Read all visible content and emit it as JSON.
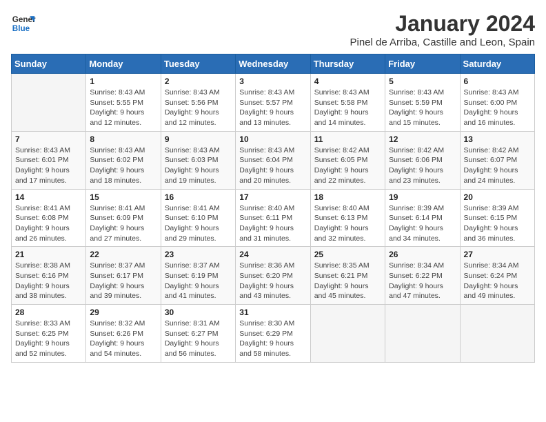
{
  "logo": {
    "line1": "General",
    "line2": "Blue"
  },
  "title": "January 2024",
  "subtitle": "Pinel de Arriba, Castille and Leon, Spain",
  "days_of_week": [
    "Sunday",
    "Monday",
    "Tuesday",
    "Wednesday",
    "Thursday",
    "Friday",
    "Saturday"
  ],
  "weeks": [
    [
      {
        "num": "",
        "detail": ""
      },
      {
        "num": "1",
        "detail": "Sunrise: 8:43 AM\nSunset: 5:55 PM\nDaylight: 9 hours\nand 12 minutes."
      },
      {
        "num": "2",
        "detail": "Sunrise: 8:43 AM\nSunset: 5:56 PM\nDaylight: 9 hours\nand 12 minutes."
      },
      {
        "num": "3",
        "detail": "Sunrise: 8:43 AM\nSunset: 5:57 PM\nDaylight: 9 hours\nand 13 minutes."
      },
      {
        "num": "4",
        "detail": "Sunrise: 8:43 AM\nSunset: 5:58 PM\nDaylight: 9 hours\nand 14 minutes."
      },
      {
        "num": "5",
        "detail": "Sunrise: 8:43 AM\nSunset: 5:59 PM\nDaylight: 9 hours\nand 15 minutes."
      },
      {
        "num": "6",
        "detail": "Sunrise: 8:43 AM\nSunset: 6:00 PM\nDaylight: 9 hours\nand 16 minutes."
      }
    ],
    [
      {
        "num": "7",
        "detail": "Sunrise: 8:43 AM\nSunset: 6:01 PM\nDaylight: 9 hours\nand 17 minutes."
      },
      {
        "num": "8",
        "detail": "Sunrise: 8:43 AM\nSunset: 6:02 PM\nDaylight: 9 hours\nand 18 minutes."
      },
      {
        "num": "9",
        "detail": "Sunrise: 8:43 AM\nSunset: 6:03 PM\nDaylight: 9 hours\nand 19 minutes."
      },
      {
        "num": "10",
        "detail": "Sunrise: 8:43 AM\nSunset: 6:04 PM\nDaylight: 9 hours\nand 20 minutes."
      },
      {
        "num": "11",
        "detail": "Sunrise: 8:42 AM\nSunset: 6:05 PM\nDaylight: 9 hours\nand 22 minutes."
      },
      {
        "num": "12",
        "detail": "Sunrise: 8:42 AM\nSunset: 6:06 PM\nDaylight: 9 hours\nand 23 minutes."
      },
      {
        "num": "13",
        "detail": "Sunrise: 8:42 AM\nSunset: 6:07 PM\nDaylight: 9 hours\nand 24 minutes."
      }
    ],
    [
      {
        "num": "14",
        "detail": "Sunrise: 8:41 AM\nSunset: 6:08 PM\nDaylight: 9 hours\nand 26 minutes."
      },
      {
        "num": "15",
        "detail": "Sunrise: 8:41 AM\nSunset: 6:09 PM\nDaylight: 9 hours\nand 27 minutes."
      },
      {
        "num": "16",
        "detail": "Sunrise: 8:41 AM\nSunset: 6:10 PM\nDaylight: 9 hours\nand 29 minutes."
      },
      {
        "num": "17",
        "detail": "Sunrise: 8:40 AM\nSunset: 6:11 PM\nDaylight: 9 hours\nand 31 minutes."
      },
      {
        "num": "18",
        "detail": "Sunrise: 8:40 AM\nSunset: 6:13 PM\nDaylight: 9 hours\nand 32 minutes."
      },
      {
        "num": "19",
        "detail": "Sunrise: 8:39 AM\nSunset: 6:14 PM\nDaylight: 9 hours\nand 34 minutes."
      },
      {
        "num": "20",
        "detail": "Sunrise: 8:39 AM\nSunset: 6:15 PM\nDaylight: 9 hours\nand 36 minutes."
      }
    ],
    [
      {
        "num": "21",
        "detail": "Sunrise: 8:38 AM\nSunset: 6:16 PM\nDaylight: 9 hours\nand 38 minutes."
      },
      {
        "num": "22",
        "detail": "Sunrise: 8:37 AM\nSunset: 6:17 PM\nDaylight: 9 hours\nand 39 minutes."
      },
      {
        "num": "23",
        "detail": "Sunrise: 8:37 AM\nSunset: 6:19 PM\nDaylight: 9 hours\nand 41 minutes."
      },
      {
        "num": "24",
        "detail": "Sunrise: 8:36 AM\nSunset: 6:20 PM\nDaylight: 9 hours\nand 43 minutes."
      },
      {
        "num": "25",
        "detail": "Sunrise: 8:35 AM\nSunset: 6:21 PM\nDaylight: 9 hours\nand 45 minutes."
      },
      {
        "num": "26",
        "detail": "Sunrise: 8:34 AM\nSunset: 6:22 PM\nDaylight: 9 hours\nand 47 minutes."
      },
      {
        "num": "27",
        "detail": "Sunrise: 8:34 AM\nSunset: 6:24 PM\nDaylight: 9 hours\nand 49 minutes."
      }
    ],
    [
      {
        "num": "28",
        "detail": "Sunrise: 8:33 AM\nSunset: 6:25 PM\nDaylight: 9 hours\nand 52 minutes."
      },
      {
        "num": "29",
        "detail": "Sunrise: 8:32 AM\nSunset: 6:26 PM\nDaylight: 9 hours\nand 54 minutes."
      },
      {
        "num": "30",
        "detail": "Sunrise: 8:31 AM\nSunset: 6:27 PM\nDaylight: 9 hours\nand 56 minutes."
      },
      {
        "num": "31",
        "detail": "Sunrise: 8:30 AM\nSunset: 6:29 PM\nDaylight: 9 hours\nand 58 minutes."
      },
      {
        "num": "",
        "detail": ""
      },
      {
        "num": "",
        "detail": ""
      },
      {
        "num": "",
        "detail": ""
      }
    ]
  ]
}
